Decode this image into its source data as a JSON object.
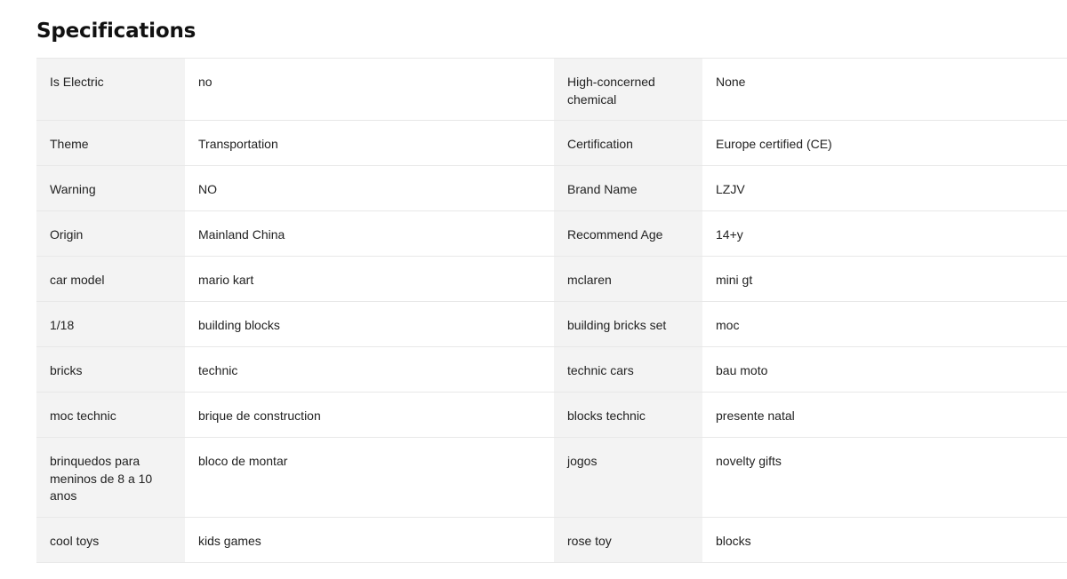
{
  "page": {
    "title": "Specifications"
  },
  "specs": [
    {
      "k1": "Is Electric",
      "v1": "no",
      "k2": "High-concerned chemical",
      "v2": "None"
    },
    {
      "k1": "Theme",
      "v1": "Transportation",
      "k2": "Certification",
      "v2": "Europe certified (CE)"
    },
    {
      "k1": "Warning",
      "v1": "NO",
      "k2": "Brand Name",
      "v2": "LZJV"
    },
    {
      "k1": "Origin",
      "v1": "Mainland China",
      "k2": "Recommend Age",
      "v2": "14+y"
    },
    {
      "k1": "car model",
      "v1": "mario kart",
      "k2": "mclaren",
      "v2": "mini gt"
    },
    {
      "k1": "1/18",
      "v1": "building blocks",
      "k2": "building bricks set",
      "v2": "moc"
    },
    {
      "k1": "bricks",
      "v1": "technic",
      "k2": "technic cars",
      "v2": "bau moto"
    },
    {
      "k1": "moc technic",
      "v1": "brique de construction",
      "k2": "blocks technic",
      "v2": "presente natal"
    },
    {
      "k1": "brinquedos para meninos de 8 a 10 anos",
      "v1": "bloco de montar",
      "k2": "jogos",
      "v2": "novelty gifts"
    },
    {
      "k1": "cool toys",
      "v1": "kids games",
      "k2": "rose toy",
      "v2": "blocks"
    }
  ]
}
